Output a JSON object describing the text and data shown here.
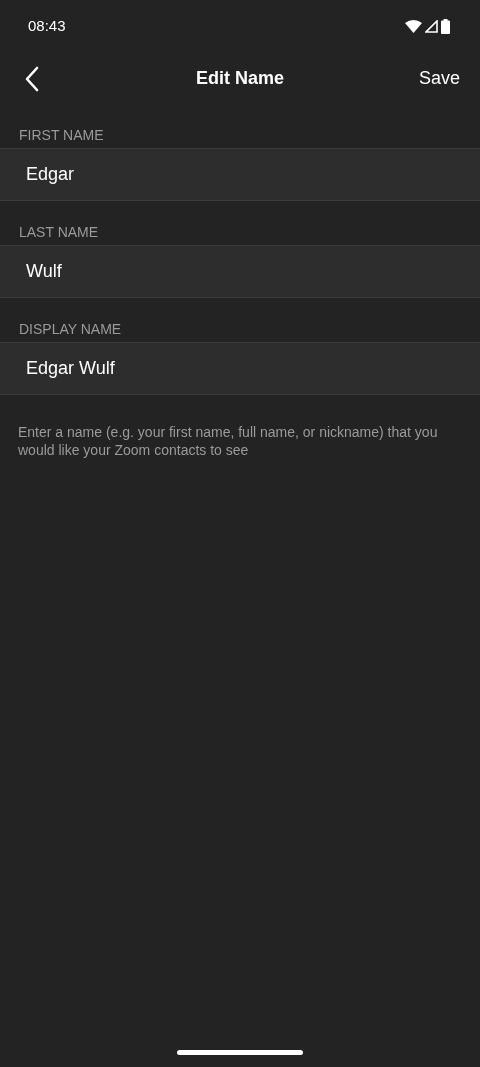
{
  "status_bar": {
    "time": "08:43"
  },
  "header": {
    "title": "Edit Name",
    "action": "Save"
  },
  "fields": [
    {
      "label": "FIRST NAME",
      "value": "Edgar"
    },
    {
      "label": "LAST NAME",
      "value": "Wulf"
    },
    {
      "label": "DISPLAY NAME",
      "value": "Edgar Wulf"
    }
  ],
  "hint": "Enter a name (e.g. your first name, full name, or nickname) that you would like your Zoom contacts to see"
}
